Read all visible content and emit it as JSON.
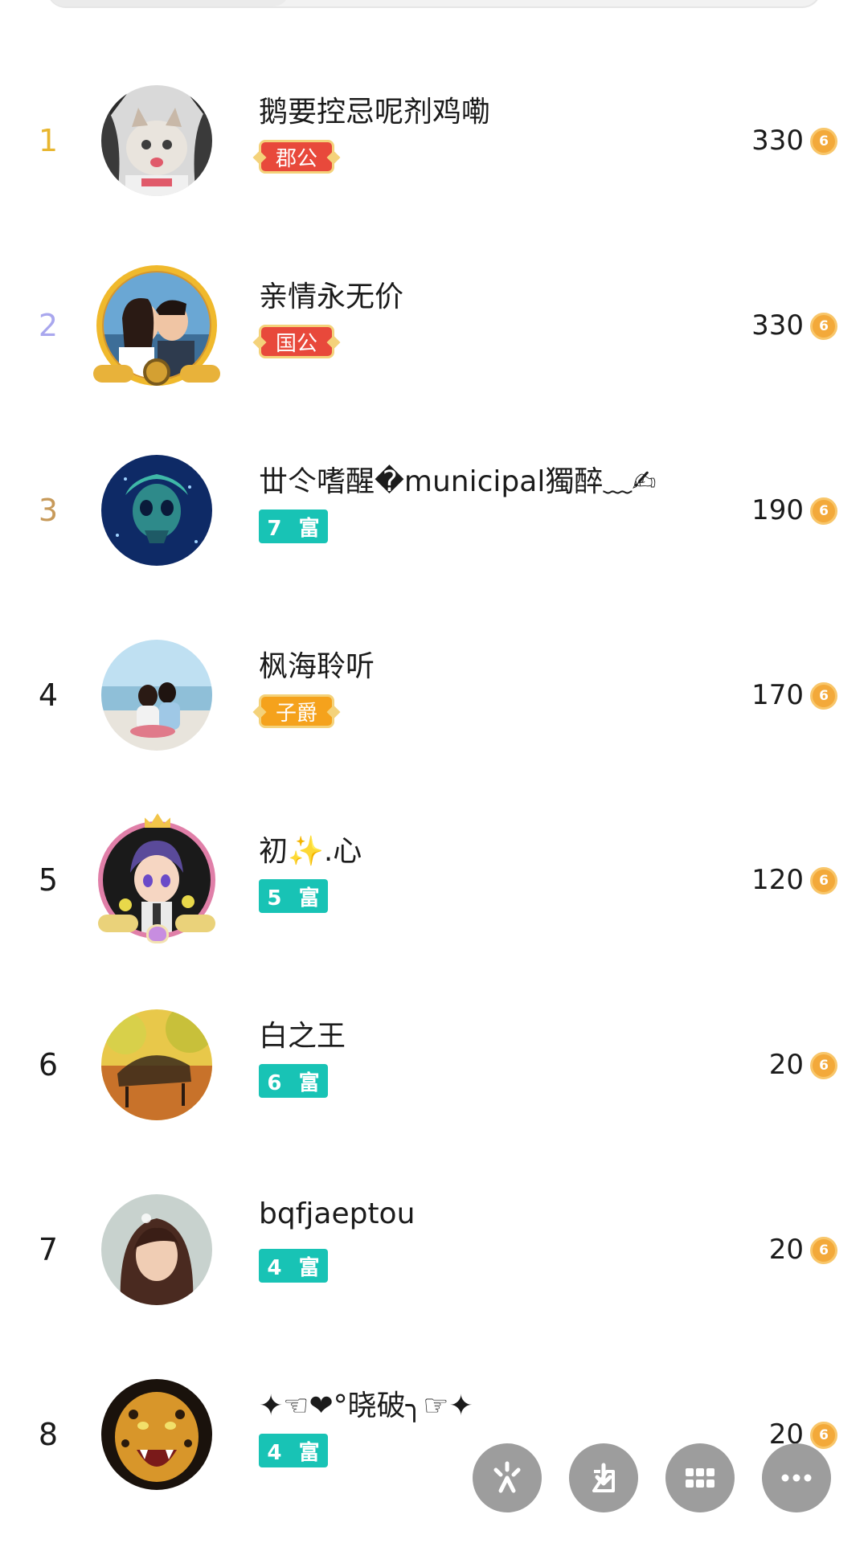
{
  "colors": {
    "rank_gold": "#e8b630",
    "rank_silver": "#a9a7ee",
    "rank_bronze": "#c79a5a",
    "teal_badge": "#18c3b5",
    "red_badge": "#e8493b",
    "orange_badge": "#f5a21c",
    "coin": "#f3a93a",
    "fab": "#9d9d9d"
  },
  "ranking": [
    {
      "rank": "1",
      "name": "鹅要控忌呢剂鸡嘞",
      "badge": "郡公",
      "badge_style": "red",
      "score": "330",
      "avatar": "cat-in-hoodie-avatar"
    },
    {
      "rank": "2",
      "name": "亲情永无价",
      "badge": "国公",
      "badge_style": "red",
      "score": "330",
      "avatar": "couple-kiss-avatar"
    },
    {
      "rank": "3",
      "name": "丗仒嗜醒�municipal獨醉﹏✍",
      "badge": "7 富",
      "badge_style": "teal",
      "score": "190",
      "avatar": "blue-skull-avatar"
    },
    {
      "rank": "4",
      "name": "枫海聆听",
      "badge": "子爵",
      "badge_style": "orange",
      "score": "170",
      "avatar": "couple-beach-avatar"
    },
    {
      "rank": "5",
      "name": "初✨.心",
      "badge": "5 富",
      "badge_style": "teal",
      "score": "120",
      "avatar": "anime-boy-avatar"
    },
    {
      "rank": "6",
      "name": "白之王",
      "badge": "6 富",
      "badge_style": "teal",
      "score": "20",
      "avatar": "autumn-bench-avatar"
    },
    {
      "rank": "7",
      "name": "bqfjaeptou",
      "badge": "4 富",
      "badge_style": "teal",
      "score": "20",
      "avatar": "girl-portrait-avatar"
    },
    {
      "rank": "8",
      "name": "✦☜❤°晓破╮☞✦",
      "badge": "4 富",
      "badge_style": "teal",
      "score": "20",
      "avatar": "leopard-avatar"
    }
  ],
  "coin_icon": "coin-icon",
  "coin_glyph": "6",
  "fabs": [
    {
      "icon": "tap-icon"
    },
    {
      "icon": "download-icon"
    },
    {
      "icon": "grid-icon"
    },
    {
      "icon": "more-icon"
    }
  ]
}
